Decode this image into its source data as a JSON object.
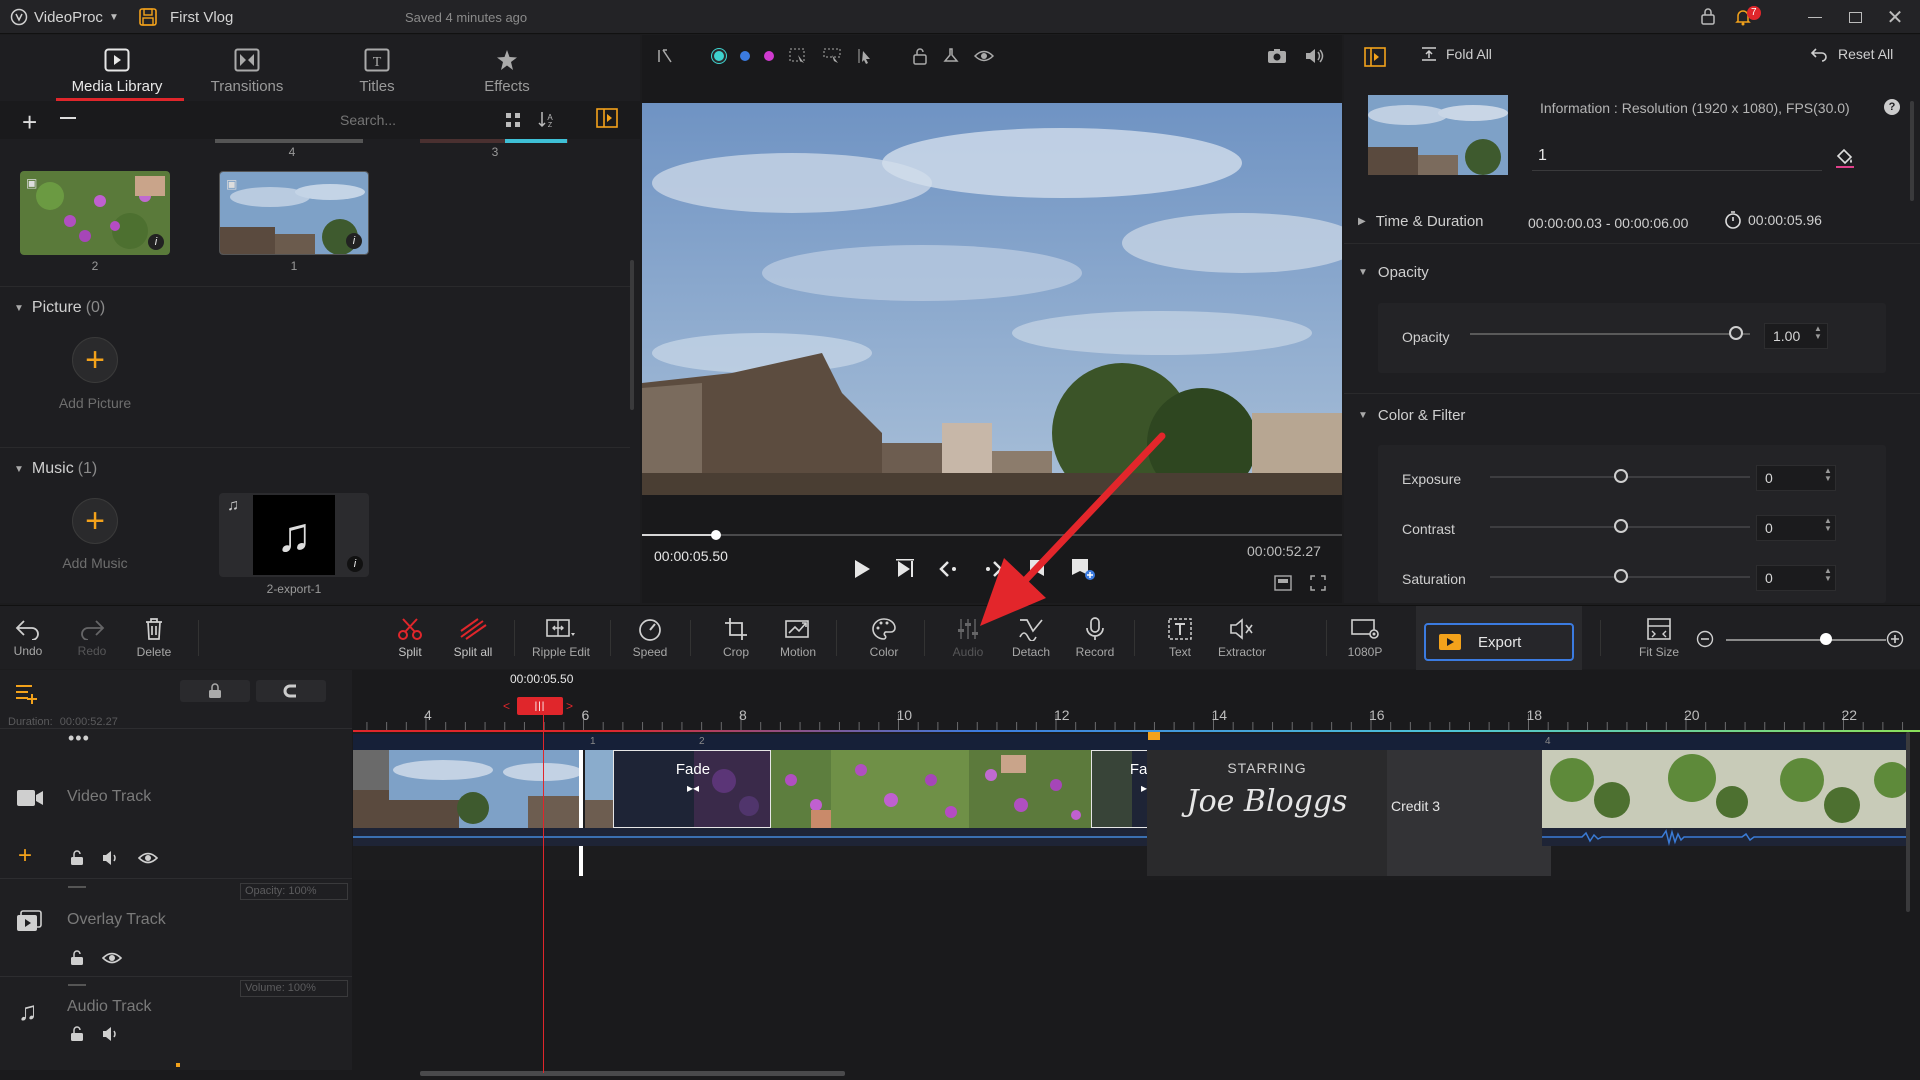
{
  "app": {
    "name": "VideoProc",
    "project": "First Vlog",
    "saved_status": "Saved 4 minutes ago",
    "notification_count": "7"
  },
  "library": {
    "tabs": [
      {
        "label": "Media Library",
        "icon": "film-icon"
      },
      {
        "label": "Transitions",
        "icon": "transition-icon"
      },
      {
        "label": "Titles",
        "icon": "title-icon"
      },
      {
        "label": "Effects",
        "icon": "effects-star-icon"
      }
    ],
    "search_placeholder": "Search...",
    "top_captions": [
      "4",
      "3"
    ],
    "video_items": [
      {
        "caption": "2"
      },
      {
        "caption": "1"
      }
    ],
    "picture_section": {
      "title": "Picture",
      "count": "(0)",
      "add_label": "Add Picture"
    },
    "music_section": {
      "title": "Music",
      "count": "(1)",
      "add_label": "Add Music",
      "item_caption": "2-export-1"
    }
  },
  "preview": {
    "current_time": "00:00:05.50",
    "total_time": "00:00:52.27",
    "progress": 0.105
  },
  "properties": {
    "fold_all": "Fold All",
    "reset_all": "Reset All",
    "info": "Information : Resolution (1920 x 1080), FPS(30.0)",
    "clip_name": "1",
    "time_duration_label": "Time & Duration",
    "time_range": "00:00:00.03 - 00:00:06.00",
    "duration": "00:00:05.96",
    "opacity_section": "Opacity",
    "opacity_label": "Opacity",
    "opacity_value": "1.00",
    "color_section": "Color & Filter",
    "exposure_label": "Exposure",
    "exposure_value": "0",
    "contrast_label": "Contrast",
    "contrast_value": "0",
    "saturation_label": "Saturation",
    "saturation_value": "0"
  },
  "toolbar": {
    "undo": "Undo",
    "redo": "Redo",
    "delete": "Delete",
    "split": "Split",
    "split_all": "Split all",
    "ripple_edit": "Ripple Edit",
    "speed": "Speed",
    "crop": "Crop",
    "motion": "Motion",
    "color": "Color",
    "audio": "Audio",
    "detach": "Detach",
    "record": "Record",
    "text": "Text",
    "extractor": "Extractor",
    "resolution": "1080P",
    "export": "Export",
    "fit_size": "Fit Size"
  },
  "timeline": {
    "playhead_time": "00:00:05.50",
    "duration_label": "Duration:",
    "duration_value": "00:00:52.27",
    "ruler_labels": [
      "4",
      "6",
      "8",
      "10",
      "12",
      "14",
      "16",
      "18",
      "20",
      "22"
    ],
    "tracks": {
      "video": "Video Track",
      "overlay": "Overlay Track",
      "audio": "Audio Track"
    },
    "overlay_opacity": "Opacity: 100%",
    "audio_volume": "Volume: 100%",
    "clip_numbers": [
      "1",
      "2",
      "4"
    ],
    "transition1": "Fade",
    "transition2": "Fade",
    "title_clip_line1": "STARRING",
    "title_clip_line2": "Joe Bloggs",
    "credit_clip": "Credit 3"
  },
  "colors": {
    "accent_orange": "#f3a21b",
    "playhead_red": "#e0262b",
    "export_border": "#3b7be0",
    "annotation_arrow": "#e3262b"
  }
}
